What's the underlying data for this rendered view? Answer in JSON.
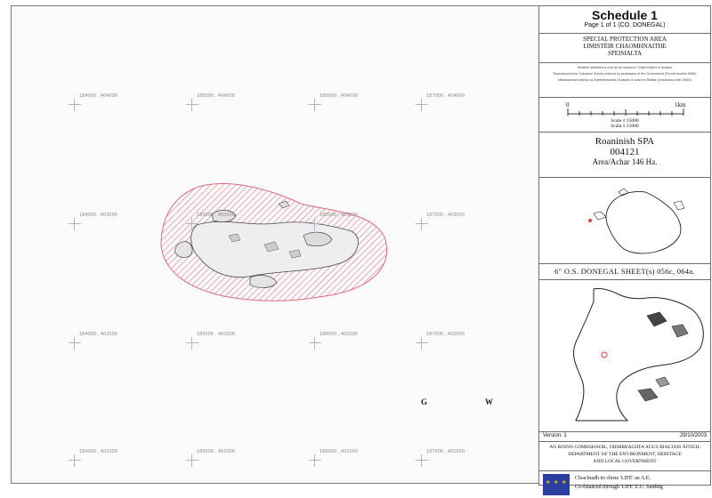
{
  "grid_labels": {
    "row1": [
      "184000 , 404000",
      "185000 , 404000",
      "186000 , 404000",
      "187000 , 404000"
    ],
    "row2": [
      "184000 , 403000",
      "185000 , 403000",
      "186000 , 403000",
      "187000 , 403000"
    ],
    "row3": [
      "184000 , 402000",
      "185000 , 402000",
      "186000 , 402000",
      "187000 , 402000"
    ],
    "row4": [
      "184000 , 401000",
      "185000 , 401000",
      "186000 , 401000",
      "187000 , 401000"
    ]
  },
  "gw": [
    "G",
    "W"
  ],
  "panel": {
    "title": "Schedule 1",
    "subtitle": "Page 1 of 1 (CO. DONEGAL)",
    "area_en": "SPECIAL PROTECTION AREA",
    "area_ga1": "LIMISTÉIR CHAOMHNAITHE",
    "area_ga2": "SPEISIALTA",
    "notes": [
      "Weather attributes a chur as an ordnance / Data subject to revision",
      "Reproduced from Ordnance Survey material by permission of the Government (Permit Number 8960)",
      "Macasamhail d'abhar na Suirbhéireachta Ordanáis le cead ón Rialtas (Ceadúnas Uimh. 8960)"
    ],
    "scale_start": "0",
    "scale_end": "1km",
    "scale1": "Scale 1:15000",
    "scale2": "Scála 1:15000",
    "site_name": "Roaninish SPA",
    "site_code": "004121",
    "site_area": "Area/Achar 146 Ha.",
    "sheet": "6\" O.S. DONEGAL SHEET(s) 056c, 064a.",
    "version": "Version: 1",
    "date": "29/10/2003",
    "dept1": "AN ROINN COMHSHAOIL, OIDHREACHTA AGUS RIALTAIS ÁITIÚIL",
    "dept2": "DEPARTMENT OF THE ENVIRONMENT, HERITAGE",
    "dept3": "AND LOCAL GOVERNMENT",
    "eu1": "Cleachtadh tri chiste 'LIFE' an A.E.",
    "eu2": "Co-financed through 'LIFE' E.U. funding"
  }
}
